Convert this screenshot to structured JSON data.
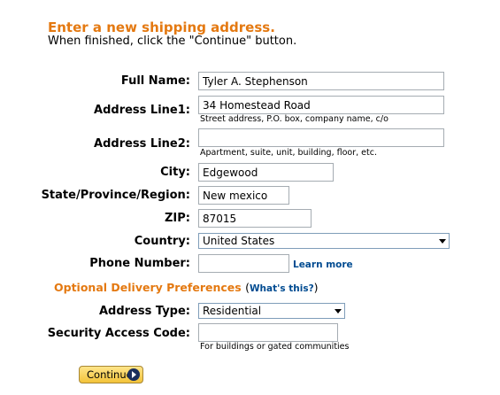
{
  "header": {
    "title": "Enter a new shipping address.",
    "subtitle": "When finished, click the \"Continue\" button."
  },
  "form": {
    "full_name": {
      "label": "Full Name:",
      "value": "Tyler A. Stephenson"
    },
    "address_line1": {
      "label": "Address Line1:",
      "value": "34 Homestead Road",
      "hint": "Street address, P.O. box, company name, c/o"
    },
    "address_line2": {
      "label": "Address Line2:",
      "value": "",
      "hint": "Apartment, suite, unit, building, floor, etc."
    },
    "city": {
      "label": "City:",
      "value": "Edgewood"
    },
    "state": {
      "label": "State/Province/Region:",
      "value": "New mexico"
    },
    "zip": {
      "label": "ZIP:",
      "value": "87015"
    },
    "country": {
      "label": "Country:",
      "selected": "United States"
    },
    "phone": {
      "label": "Phone Number:",
      "value": "",
      "link": "Learn more"
    }
  },
  "optional": {
    "heading": "Optional Delivery Preferences",
    "open_paren": "(",
    "link": "What's this?",
    "close_paren": ")",
    "address_type": {
      "label": "Address Type:",
      "selected": "Residential"
    },
    "security_code": {
      "label": "Security Access Code:",
      "value": "",
      "hint": "For buildings or gated communities"
    }
  },
  "actions": {
    "continue_label": "Continue"
  },
  "colors": {
    "heading": "#e47911",
    "link": "#004b91",
    "button": "#f3c33a"
  },
  "icons": {
    "continue_icon": "arrow-right-circle-icon",
    "dropdown_icon": "chevron-down-icon"
  }
}
